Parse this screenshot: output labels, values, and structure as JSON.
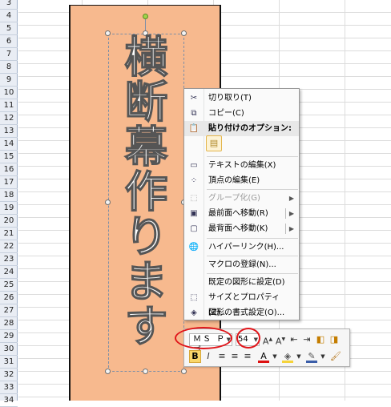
{
  "rows": [
    "3",
    "4",
    "5",
    "6",
    "7",
    "8",
    "9",
    "10",
    "11",
    "12",
    "13",
    "14",
    "15",
    "16",
    "17",
    "18",
    "19",
    "20",
    "21",
    "22",
    "23",
    "24",
    "25",
    "26",
    "27",
    "28",
    "29",
    "30",
    "31",
    "32",
    "33",
    "34"
  ],
  "shape_text": [
    "横",
    "断",
    "幕",
    "作",
    "り",
    "ま",
    "す"
  ],
  "colors": {
    "banner_fill": "#f7b98e",
    "highlight": "#e0161b",
    "rotate_handle": "#9ed449"
  },
  "menu": {
    "cut": "切り取り(T)",
    "copy": "コピー(C)",
    "paste_options": "貼り付けのオプション:",
    "edit_text": "テキストの編集(X)",
    "edit_points": "頂点の編集(E)",
    "group": "グループ化(G)",
    "bring_front": "最前面へ移動(R)",
    "send_back": "最背面へ移動(K)",
    "hyperlink": "ハイパーリンク(H)...",
    "assign_macro": "マクロの登録(N)...",
    "set_default": "既定の図形に設定(D)",
    "size_properties": "サイズとプロパティ(Z)...",
    "format_shape": "図形の書式設定(O)..."
  },
  "minitoolbar": {
    "font": "ＭＳ Ｐゴ",
    "size": "54",
    "bold": "B",
    "italic": "I"
  },
  "icons": [
    "scissors-icon",
    "copy-icon",
    "paste-icon",
    "clipboard-icon",
    "edit-text-icon",
    "edit-points-icon",
    "group-icon",
    "bring-front-icon",
    "send-back-icon",
    "hyperlink-icon",
    "macro-icon",
    "default-shape-icon",
    "size-properties-icon",
    "format-shape-icon"
  ]
}
